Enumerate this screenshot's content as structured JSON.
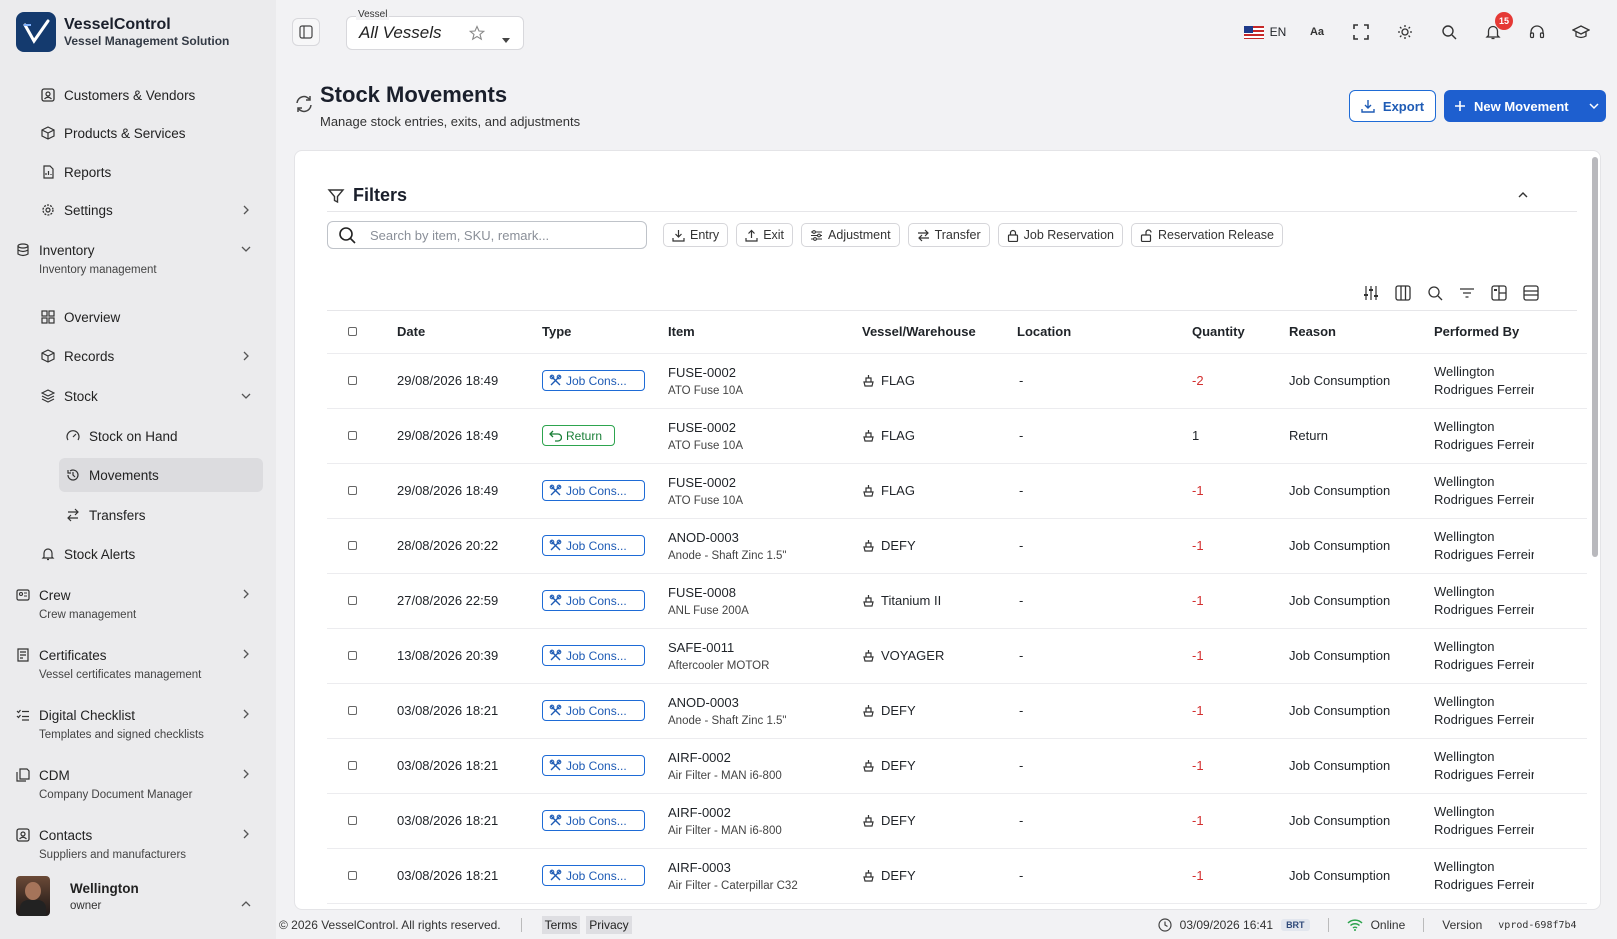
{
  "app": {
    "name": "VesselControl",
    "subtitle": "Vessel Management Solution"
  },
  "topbar": {
    "vessel_label": "Vessel",
    "vessel_value": "All Vessels",
    "lang": "EN",
    "notifications": "15"
  },
  "sidebar": {
    "items": {
      "customers": "Customers & Vendors",
      "products": "Products & Services",
      "reports": "Reports",
      "settings": "Settings",
      "inventory": "Inventory",
      "inventory_desc": "Inventory management",
      "overview": "Overview",
      "records": "Records",
      "stock": "Stock",
      "stock_on_hand": "Stock on Hand",
      "movements": "Movements",
      "transfers": "Transfers",
      "stock_alerts": "Stock Alerts",
      "crew": "Crew",
      "crew_desc": "Crew management",
      "certificates": "Certificates",
      "certificates_desc": "Vessel certificates management",
      "checklist": "Digital Checklist",
      "checklist_desc": "Templates and signed checklists",
      "cdm": "CDM",
      "cdm_desc": "Company Document Manager",
      "contacts": "Contacts",
      "contacts_desc": "Suppliers and manufacturers"
    },
    "user": {
      "name": "Wellington",
      "role": "owner"
    }
  },
  "page": {
    "title": "Stock Movements",
    "subtitle": "Manage stock entries, exits, and adjustments",
    "export_label": "Export",
    "new_label": "New Movement"
  },
  "filters": {
    "title": "Filters",
    "search_placeholder": "Search by item, SKU, remark...",
    "chips": [
      "Entry",
      "Exit",
      "Adjustment",
      "Transfer",
      "Job Reservation",
      "Reservation Release"
    ]
  },
  "table": {
    "headers": [
      "Date",
      "Type",
      "Item",
      "Vessel/Warehouse",
      "Location",
      "Quantity",
      "Reason",
      "Performed By"
    ],
    "rows": [
      {
        "date": "29/08/2026 18:49",
        "type": "Job Cons...",
        "kind": "job",
        "sku": "FUSE-0002",
        "name": "ATO Fuse 10A",
        "vessel": "FLAG",
        "location": "-",
        "qty": "-2",
        "reason": "Job Consumption",
        "by1": "Wellington",
        "by2": "Rodrigues Ferreira"
      },
      {
        "date": "29/08/2026 18:49",
        "type": "Return",
        "kind": "return",
        "sku": "FUSE-0002",
        "name": "ATO Fuse 10A",
        "vessel": "FLAG",
        "location": "-",
        "qty": "1",
        "reason": "Return",
        "by1": "Wellington",
        "by2": "Rodrigues Ferreira"
      },
      {
        "date": "29/08/2026 18:49",
        "type": "Job Cons...",
        "kind": "job",
        "sku": "FUSE-0002",
        "name": "ATO Fuse 10A",
        "vessel": "FLAG",
        "location": "-",
        "qty": "-1",
        "reason": "Job Consumption",
        "by1": "Wellington",
        "by2": "Rodrigues Ferreira"
      },
      {
        "date": "28/08/2026 20:22",
        "type": "Job Cons...",
        "kind": "job",
        "sku": "ANOD-0003",
        "name": "Anode - Shaft Zinc 1.5\"",
        "vessel": "DEFY",
        "location": "-",
        "qty": "-1",
        "reason": "Job Consumption",
        "by1": "Wellington",
        "by2": "Rodrigues Ferreira"
      },
      {
        "date": "27/08/2026 22:59",
        "type": "Job Cons...",
        "kind": "job",
        "sku": "FUSE-0008",
        "name": "ANL Fuse 200A",
        "vessel": "Titanium II",
        "location": "-",
        "qty": "-1",
        "reason": "Job Consumption",
        "by1": "Wellington",
        "by2": "Rodrigues Ferreira"
      },
      {
        "date": "13/08/2026 20:39",
        "type": "Job Cons...",
        "kind": "job",
        "sku": "SAFE-0011",
        "name": "Aftercooler MOTOR",
        "vessel": "VOYAGER",
        "location": "-",
        "qty": "-1",
        "reason": "Job Consumption",
        "by1": "Wellington",
        "by2": "Rodrigues Ferreira"
      },
      {
        "date": "03/08/2026 18:21",
        "type": "Job Cons...",
        "kind": "job",
        "sku": "ANOD-0003",
        "name": "Anode - Shaft Zinc 1.5\"",
        "vessel": "DEFY",
        "location": "-",
        "qty": "-1",
        "reason": "Job Consumption",
        "by1": "Wellington",
        "by2": "Rodrigues Ferreira"
      },
      {
        "date": "03/08/2026 18:21",
        "type": "Job Cons...",
        "kind": "job",
        "sku": "AIRF-0002",
        "name": "Air Filter - MAN i6-800",
        "vessel": "DEFY",
        "location": "-",
        "qty": "-1",
        "reason": "Job Consumption",
        "by1": "Wellington",
        "by2": "Rodrigues Ferreira"
      },
      {
        "date": "03/08/2026 18:21",
        "type": "Job Cons...",
        "kind": "job",
        "sku": "AIRF-0002",
        "name": "Air Filter - MAN i6-800",
        "vessel": "DEFY",
        "location": "-",
        "qty": "-1",
        "reason": "Job Consumption",
        "by1": "Wellington",
        "by2": "Rodrigues Ferreira"
      },
      {
        "date": "03/08/2026 18:21",
        "type": "Job Cons...",
        "kind": "job",
        "sku": "AIRF-0003",
        "name": "Air Filter - Caterpillar C32",
        "vessel": "DEFY",
        "location": "-",
        "qty": "-1",
        "reason": "Job Consumption",
        "by1": "Wellington",
        "by2": "Rodrigues Ferreira"
      }
    ]
  },
  "footer": {
    "copyright": "© 2026 VesselControl. All rights reserved.",
    "terms": "Terms",
    "privacy": "Privacy",
    "datetime": "03/09/2026 16:41",
    "tz": "BRT",
    "status": "Online",
    "version_label": "Version",
    "version": "vprod-698f7b4"
  },
  "colors": {
    "accent": "#1e5fcf",
    "negative": "#d32f2f",
    "return": "#1a7f37",
    "online": "#2da44e"
  }
}
